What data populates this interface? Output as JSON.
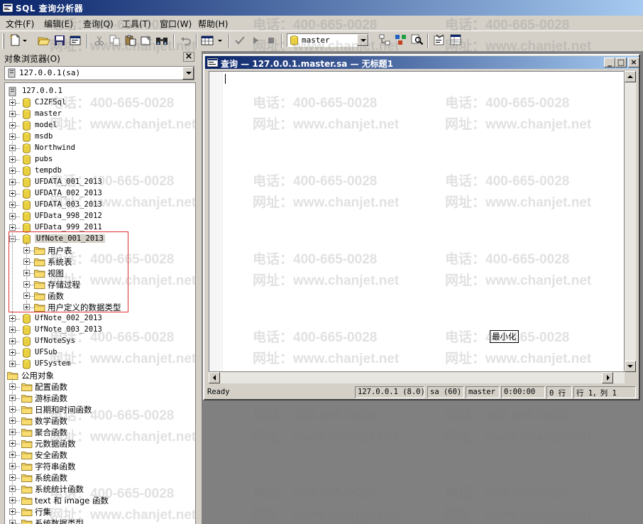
{
  "app": {
    "title": "SQL 查询分析器"
  },
  "menu": [
    "文件(F)",
    "编辑(E)",
    "查询(Q)",
    "工具(T)",
    "窗口(W)",
    "帮助(H)"
  ],
  "toolbar": {
    "database": "master"
  },
  "object_browser": {
    "title": "对象浏览器(O)",
    "close": "×",
    "server": "127.0.0.1(sa)",
    "root": "127.0.0.1",
    "databases_before": [
      "CJZFSql",
      "master",
      "model",
      "msdb",
      "Northwind",
      "pubs",
      "tempdb",
      "UFDATA_001_2013",
      "UFDATA_002_2013",
      "UFDATA_003_2013",
      "UFData_998_2012",
      "UFData_999_2011"
    ],
    "expanded_db": "UfNote_001_2013",
    "expanded_children": [
      "用户表",
      "系统表",
      "视图",
      "存储过程",
      "函数",
      "用户定义的数据类型"
    ],
    "databases_after": [
      "UfNote_002_2013",
      "UfNote_003_2013",
      "UfNoteSys",
      "UFSub",
      "UFSystem"
    ],
    "common_objects": "公用对象",
    "common_children": [
      "配置函数",
      "游标函数",
      "日期和时间函数",
      "数学函数",
      "聚合函数",
      "元数据函数",
      "安全函数",
      "字符串函数",
      "系统函数",
      "系统统计函数",
      "text 和 image 函数",
      "行集",
      "系统数据类型"
    ]
  },
  "query_window": {
    "title": "查询 — 127.0.0.1.master.sa — 无标题1",
    "minimize": "_",
    "restore": "□",
    "close": "×"
  },
  "status": {
    "state": "Ready",
    "server": "127.0.0.1 (8.0)",
    "user": "sa (60)",
    "db": "master",
    "time": "0:00:00",
    "rows": "0 行",
    "pos": "行 1，列 1"
  },
  "tooltip": "最小化",
  "watermark": {
    "phone": "电话：400-665-0028",
    "site": "网址：www.chanjet.net"
  }
}
